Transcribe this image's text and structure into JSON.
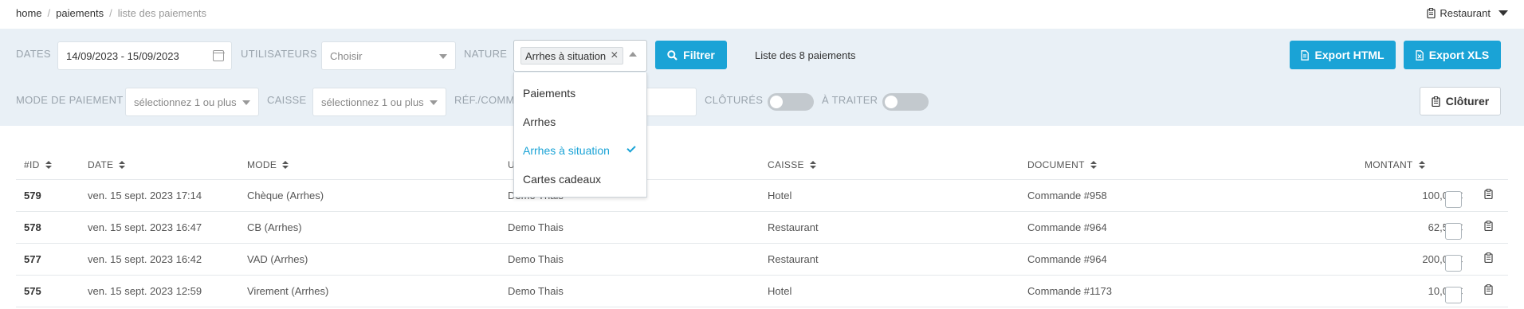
{
  "breadcrumb": {
    "home": "home",
    "payments": "paiements",
    "current": "liste des paiements"
  },
  "establishment": "Restaurant",
  "filters": {
    "dates_label": "DATES",
    "dates_value": "14/09/2023 - 15/09/2023",
    "users_label": "UTILISATEURS",
    "users_placeholder": "Choisir",
    "nature_label": "NATURE",
    "nature_tag": "Arrhes à situation",
    "filter_button": "Filtrer",
    "summary": "Liste des 8 paiements",
    "export_html": "Export HTML",
    "export_xls": "Export XLS",
    "payment_mode_label": "MODE DE PAIEMENT",
    "payment_mode_placeholder": "sélectionnez 1 ou plus",
    "cash_label": "CAISSE",
    "cash_placeholder": "sélectionnez 1 ou plus",
    "ref_label": "RÉF./COMM",
    "closed_label": "CLÔTURÉS",
    "to_process_label": "À TRAITER",
    "close_button": "Clôturer"
  },
  "nature_options": [
    {
      "label": "Paiements",
      "selected": false
    },
    {
      "label": "Arrhes",
      "selected": false
    },
    {
      "label": "Arrhes à situation",
      "selected": true
    },
    {
      "label": "Cartes cadeaux",
      "selected": false
    }
  ],
  "table": {
    "headers": {
      "id": "#ID",
      "date": "DATE",
      "mode": "MODE",
      "user": "U",
      "cash": "CAISSE",
      "document": "DOCUMENT",
      "amount": "MONTANT"
    },
    "rows": [
      {
        "id": "579",
        "date": "ven. 15 sept. 2023 17:14",
        "mode": "Chèque (Arrhes)",
        "user": "Demo Thais",
        "cash": "Hotel",
        "document": "Commande #958",
        "amount": "100,00 €"
      },
      {
        "id": "578",
        "date": "ven. 15 sept. 2023 16:47",
        "mode": "CB (Arrhes)",
        "user": "Demo Thais",
        "cash": "Restaurant",
        "document": "Commande #964",
        "amount": "62,58 €"
      },
      {
        "id": "577",
        "date": "ven. 15 sept. 2023 16:42",
        "mode": "VAD (Arrhes)",
        "user": "Demo Thais",
        "cash": "Restaurant",
        "document": "Commande #964",
        "amount": "200,00 €"
      },
      {
        "id": "575",
        "date": "ven. 15 sept. 2023 12:59",
        "mode": "Virement (Arrhes)",
        "user": "Demo Thais",
        "cash": "Hotel",
        "document": "Commande #1173",
        "amount": "10,00 €"
      }
    ]
  },
  "colors": {
    "primary": "#1aa3d6",
    "panel": "#e9f0f6"
  },
  "icons": {
    "filter": "search-icon",
    "export": "file-icon",
    "close": "clipboard-icon",
    "row_action": "clipboard-icon"
  }
}
